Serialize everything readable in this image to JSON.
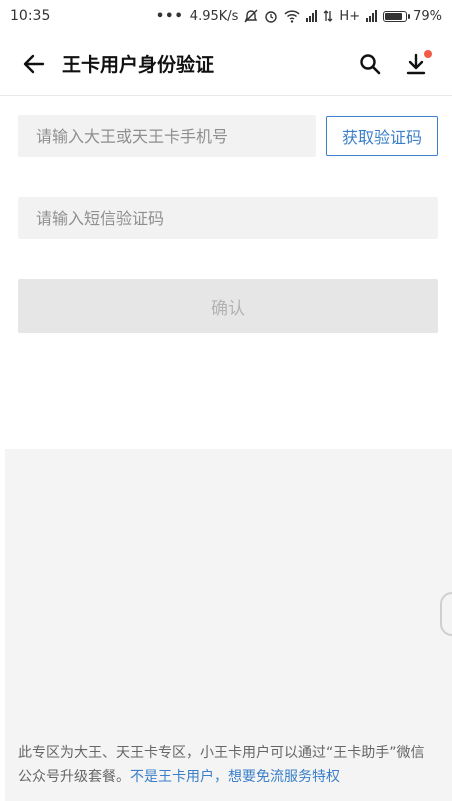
{
  "status_bar": {
    "time": "10:35",
    "dots": "•••",
    "net_speed": "4.95K/s",
    "network_type": "H+",
    "battery": "79%",
    "battery_level": 0.79
  },
  "header": {
    "title": "王卡用户身份验证"
  },
  "form": {
    "phone_placeholder": "请输入大王或天王卡手机号",
    "get_code_label": "获取验证码",
    "sms_placeholder": "请输入短信验证码",
    "confirm_label": "确认"
  },
  "footer": {
    "notice_text": "此专区为大王、天王卡专区，小王卡用户可以通过“王卡助手”微信公众号升级套餐。",
    "notice_link": "不是王卡用户，想要免流服务特权"
  },
  "colors": {
    "accent": "#3a7fc8",
    "badge": "#f15a45",
    "field_bg": "#f2f2f2",
    "disabled_btn": "#e6e6e6"
  }
}
